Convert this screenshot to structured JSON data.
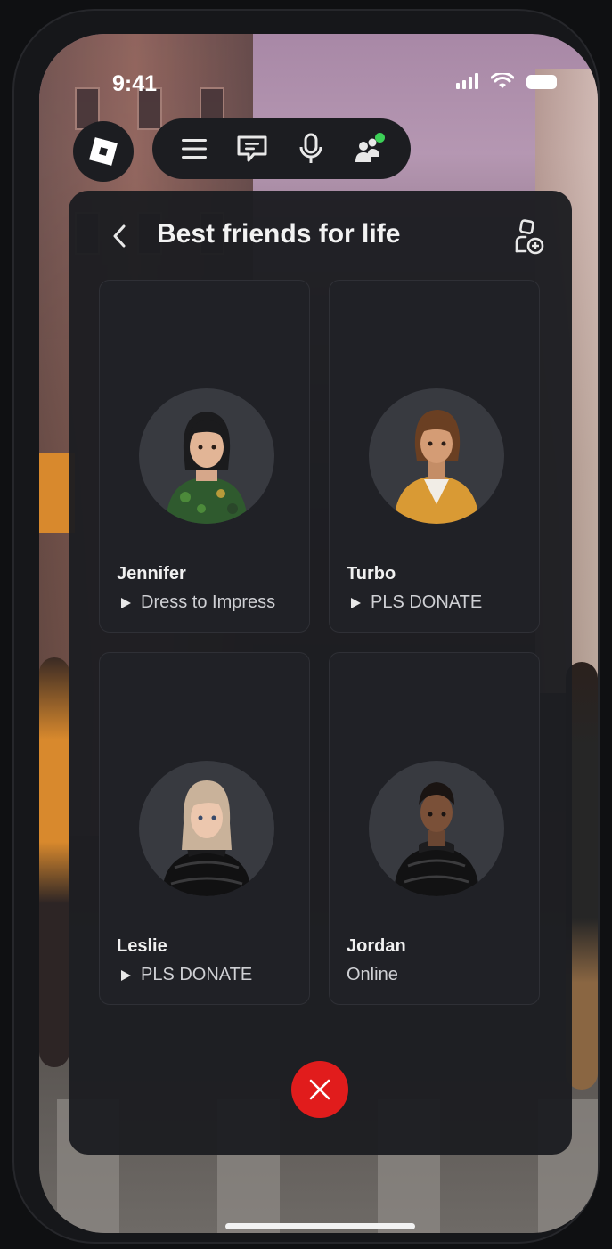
{
  "status_bar": {
    "time": "9:41"
  },
  "toolbar": {
    "icons": [
      "roblox-logo-icon",
      "menu-icon",
      "chat-icon",
      "microphone-icon",
      "friends-icon"
    ],
    "online_dot_color": "#3cd057"
  },
  "panel": {
    "title": "Best friends for life",
    "back_icon": "chevron-left-icon",
    "add_icon": "add-friend-icon"
  },
  "friends": [
    {
      "name": "Jennifer",
      "status": "Dress to Impress",
      "playing": true
    },
    {
      "name": "Turbo",
      "status": "PLS DONATE",
      "playing": true
    },
    {
      "name": "Leslie",
      "status": "PLS DONATE",
      "playing": true
    },
    {
      "name": "Jordan",
      "status": "Online",
      "playing": false
    }
  ],
  "close_button": {
    "icon": "close-icon",
    "color": "#e11c1c"
  }
}
